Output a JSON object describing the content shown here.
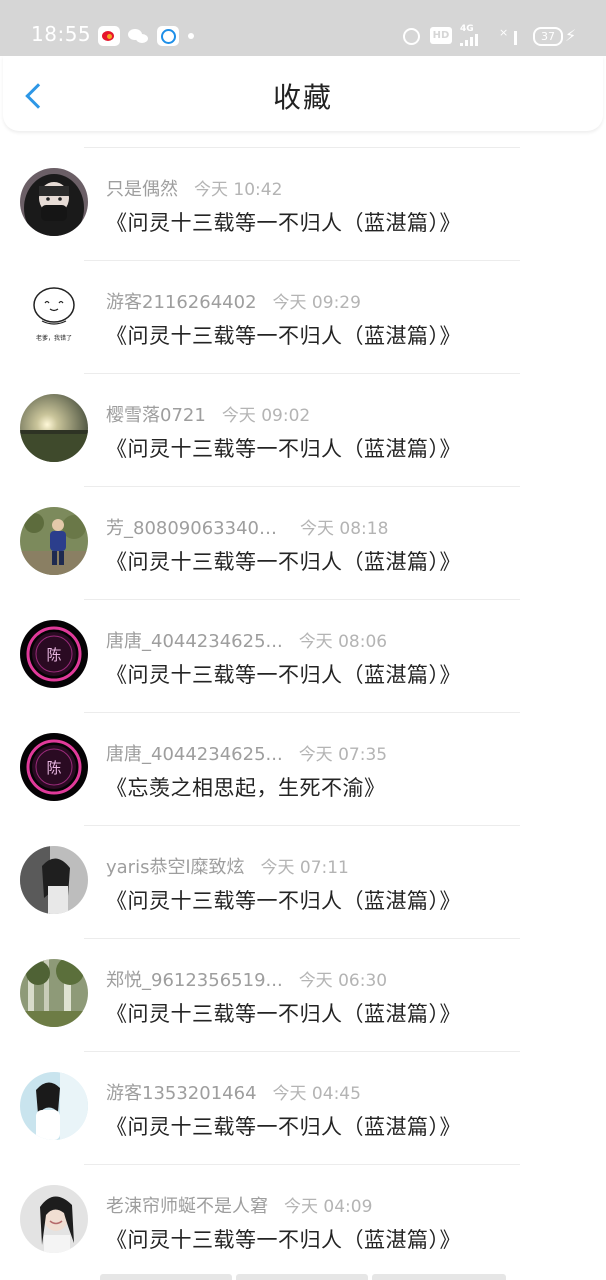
{
  "status_bar": {
    "time": "18:55",
    "network_badge": "HD",
    "network_label": "4G",
    "battery_level": "37"
  },
  "header": {
    "title": "收藏"
  },
  "items": [
    {
      "user": "只是偶然",
      "time": "今天 10:42",
      "title": "《问灵十三载等一不归人（蓝湛篇）》"
    },
    {
      "user": "游客2116264402",
      "time": "今天 09:29",
      "title": "《问灵十三载等一不归人（蓝湛篇）》",
      "avatar_text": "老爹，我错了"
    },
    {
      "user": "樱雪落0721",
      "time": "今天 09:02",
      "title": "《问灵十三载等一不归人（蓝湛篇）》"
    },
    {
      "user": "芳_808090633404...",
      "time": "今天 08:18",
      "title": "《问灵十三载等一不归人（蓝湛篇）》"
    },
    {
      "user": "唐唐_4044234625...",
      "time": "今天 08:06",
      "title": "《问灵十三载等一不归人（蓝湛篇）》",
      "avatar_text": "陈"
    },
    {
      "user": "唐唐_4044234625...",
      "time": "今天 07:35",
      "title": "《忘羡之相思起，生死不渝》",
      "avatar_text": "陈"
    },
    {
      "user": "yaris恭空l糜致炫",
      "time": "今天 07:11",
      "title": "《问灵十三载等一不归人（蓝湛篇）》"
    },
    {
      "user": "郑悦_9612356519...",
      "time": "今天 06:30",
      "title": "《问灵十三载等一不归人（蓝湛篇）》"
    },
    {
      "user": "游客1353201464",
      "time": "今天 04:45",
      "title": "《问灵十三载等一不归人（蓝湛篇）》"
    },
    {
      "user": "老涑帘师蜒不是人窘",
      "time": "今天 04:09",
      "title": "《问灵十三载等一不归人（蓝湛篇）》"
    }
  ]
}
